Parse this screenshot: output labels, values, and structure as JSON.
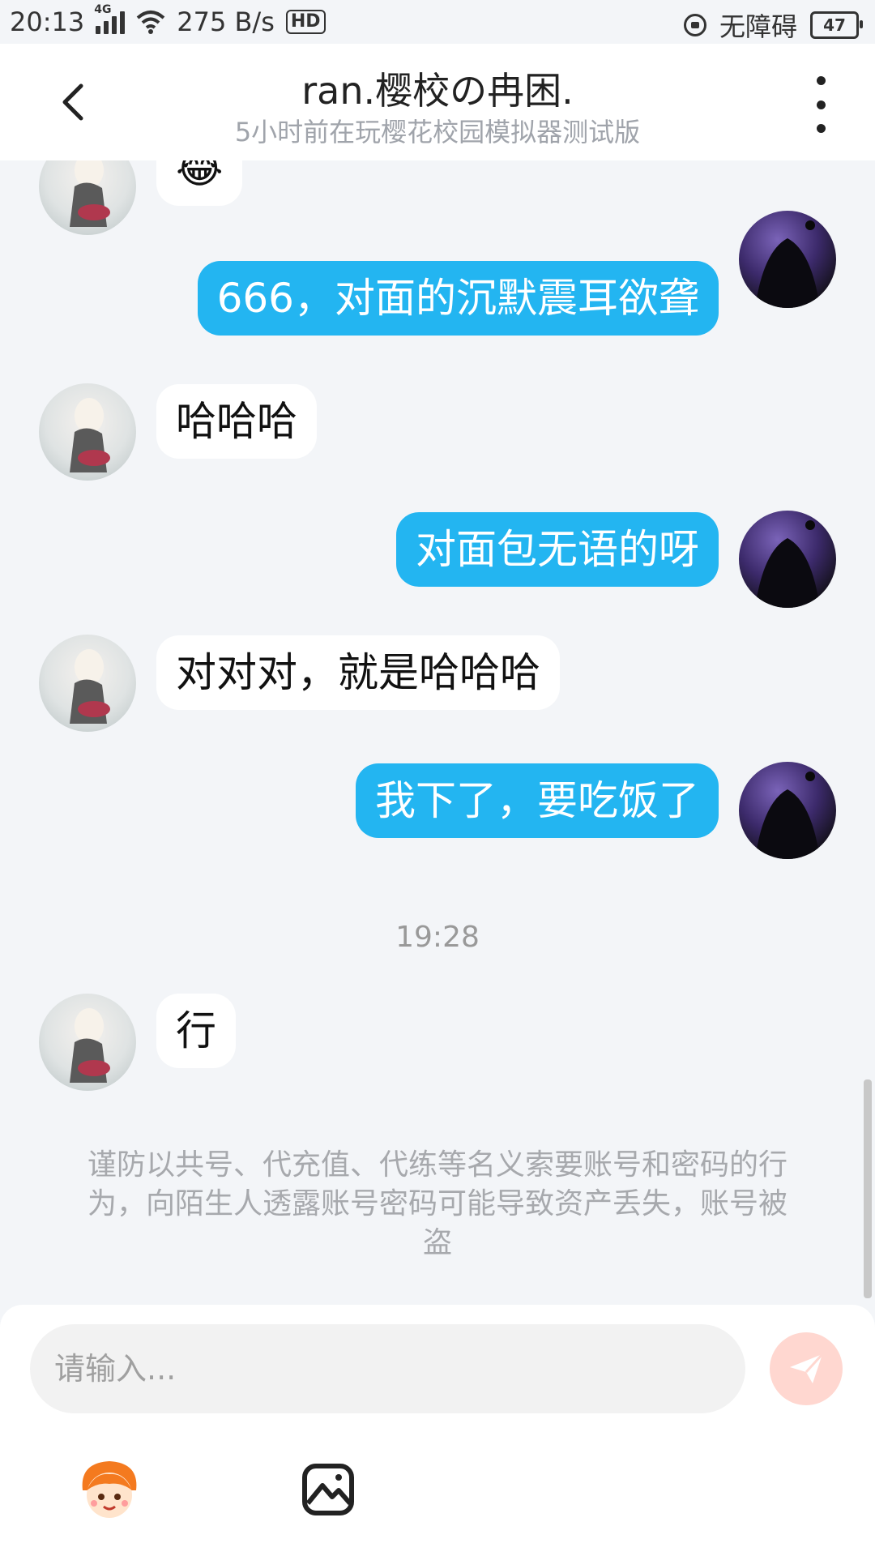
{
  "status_bar": {
    "time": "20:13",
    "network": "4G",
    "speed": "275 B/s",
    "hd": "HD",
    "accessibility": "无障碍",
    "battery": "47"
  },
  "header": {
    "title": "ran.樱校の冉困.",
    "subtitle": "5小时前在玩樱花校园模拟器测试版"
  },
  "messages": [
    {
      "from": "other",
      "text": "😂"
    },
    {
      "from": "me",
      "text": "666，对面的沉默震耳欲聋"
    },
    {
      "from": "other",
      "text": "哈哈哈"
    },
    {
      "from": "me",
      "text": "对面包无语的呀"
    },
    {
      "from": "other",
      "text": "对对对，就是哈哈哈"
    },
    {
      "from": "me",
      "text": "我下了，要吃饭了"
    },
    {
      "type": "time",
      "text": "19:28"
    },
    {
      "from": "other",
      "text": "行"
    }
  ],
  "warning": "谨防以共号、代充值、代练等名义索要账号和密码的行为，向陌生人透露账号密码可能导致资产丢失，账号被盗",
  "input": {
    "placeholder": "请输入..."
  },
  "colors": {
    "outgoing_bubble": "#23b5f1",
    "incoming_bubble": "#ffffff",
    "send_button": "#ffd7d0",
    "background": "#f3f5f8"
  },
  "icons": [
    "back-arrow-icon",
    "more-icon",
    "send-icon",
    "emoji-avatar-icon",
    "image-icon"
  ]
}
